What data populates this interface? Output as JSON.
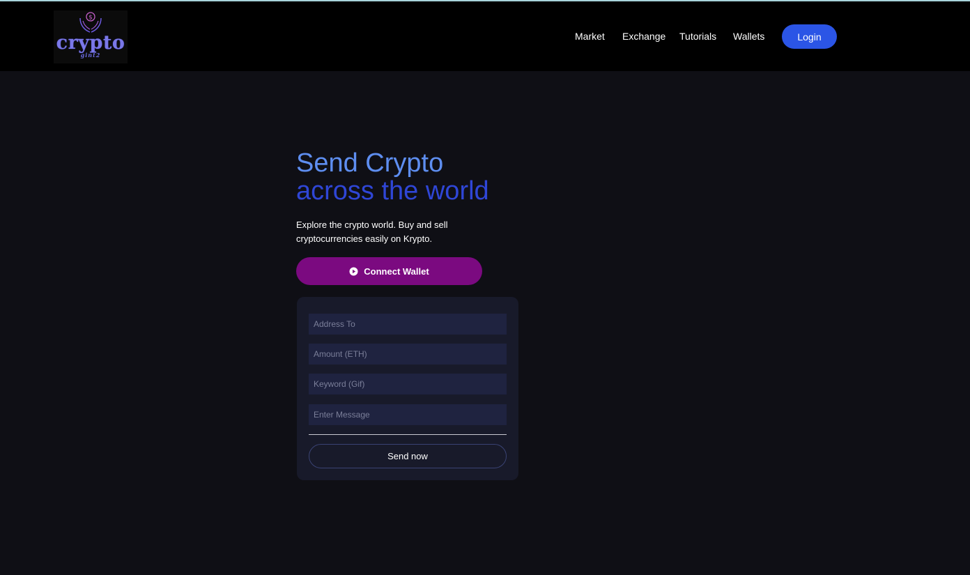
{
  "logo": {
    "word": "crypto",
    "sub": "gint2"
  },
  "nav": {
    "items": [
      "Market",
      "Exchange",
      "Tutorials",
      "Wallets"
    ],
    "login_label": "Login"
  },
  "hero": {
    "title_line1": "Send Crypto",
    "title_line2": "across the world",
    "description": "Explore the crypto world. Buy and sell cryptocurrencies easily on Krypto.",
    "connect_label": "Connect Wallet"
  },
  "form": {
    "address_placeholder": "Address To",
    "amount_placeholder": "Amount (ETH)",
    "keyword_placeholder": "Keyword (Gif)",
    "message_placeholder": "Enter Message",
    "send_label": "Send now"
  },
  "colors": {
    "header_bg": "#000000",
    "page_bg": "#0f0f15",
    "login_bg": "#2b55e6",
    "connect_bg": "#7b0a80",
    "title_light": "#5e8ef0",
    "title_dark": "#2f46d6"
  },
  "icons": {
    "connect": "play-circle-icon",
    "logo": "hands-coin-icon"
  }
}
